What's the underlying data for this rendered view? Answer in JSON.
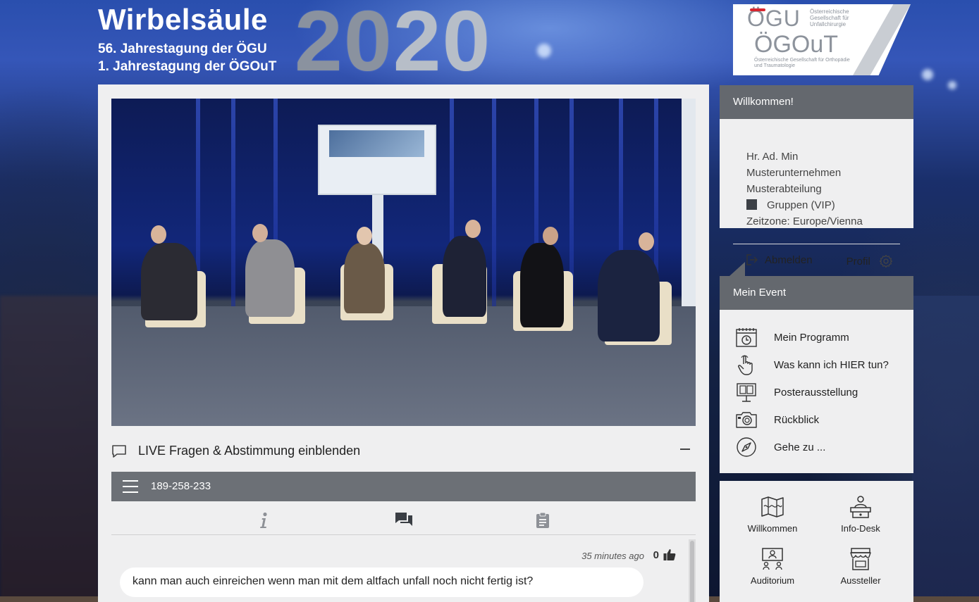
{
  "header": {
    "title": "Wirbelsäule",
    "subtitle_1": "56. Jahrestagung der ÖGU",
    "subtitle_2": "1. Jahrestagung der ÖGOuT",
    "year_1": "20",
    "year_2": "20",
    "logo_ogu": "ÖGU",
    "logo_ogu_text": "Österreichische Gesellschaft für Unfallchirurgie",
    "logo_ogout": "ÖGOuT",
    "logo_ogout_text": "Österreichische Gesellschaft für Orthopädie und Traumatologie"
  },
  "video": {
    "description_icon": "video-stream"
  },
  "live": {
    "label": "LIVE Fragen & Abstimmung einblenden"
  },
  "toolbar": {
    "code": "189-258-233"
  },
  "tabs": [
    {
      "name": "info",
      "icon": "info-icon"
    },
    {
      "name": "chat",
      "icon": "chat-icon"
    },
    {
      "name": "poll",
      "icon": "clipboard-icon"
    }
  ],
  "chat": {
    "messages": [
      {
        "time": "35 minutes ago",
        "likes": "0",
        "text": "kann man auch einreichen wenn man mit dem altfach unfall noch nicht fertig ist?"
      }
    ]
  },
  "welcome": {
    "title": "Willkommen!",
    "name": "Hr. Ad. Min",
    "company": "Musterunternehmen",
    "department": "Musterabteilung",
    "group": "Gruppen (VIP)",
    "timezone": "Zeitzone: Europe/Vienna",
    "logout": "Abmelden",
    "profile": "Profil"
  },
  "my_event": {
    "title": "Mein Event",
    "items": [
      {
        "label": "Mein Programm",
        "icon": "calendar-clock-icon"
      },
      {
        "label": "Was kann ich HIER tun?",
        "icon": "hand-pointer-icon"
      },
      {
        "label": "Posterausstellung",
        "icon": "poster-board-icon"
      },
      {
        "label": "Rückblick",
        "icon": "camera-icon"
      },
      {
        "label": "Gehe zu ...",
        "icon": "compass-icon"
      }
    ]
  },
  "nav": {
    "tiles": [
      {
        "label": "Willkommen",
        "icon": "map-icon"
      },
      {
        "label": "Info-Desk",
        "icon": "info-desk-icon"
      },
      {
        "label": "Auditorium",
        "icon": "auditorium-icon"
      },
      {
        "label": "Aussteller",
        "icon": "booth-icon"
      }
    ]
  },
  "colors": {
    "panel_bg": "#efeff0",
    "header_bar": "#64686e",
    "toolbar": "#6c7076",
    "accent_red": "#d8262f"
  }
}
